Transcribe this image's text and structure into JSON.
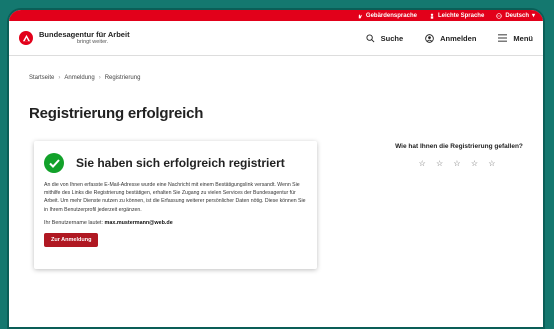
{
  "utility_bar": {
    "sign_language": "Gebärdensprache",
    "easy_language": "Leichte Sprache",
    "language": "Deutsch"
  },
  "header": {
    "logo_title": "Bundesagentur für Arbeit",
    "logo_tagline": "bringt weiter.",
    "search": "Suche",
    "login": "Anmelden",
    "menu": "Menü"
  },
  "breadcrumb": [
    "Startseite",
    "Anmeldung",
    "Registrierung"
  ],
  "page_title": "Registrierung erfolgreich",
  "card": {
    "title": "Sie haben sich erfolgreich registriert",
    "body": "An die von Ihnen erfasste E-Mail-Adresse wurde eine Nachricht mit einem Bestätigungslink versandt. Wenn Sie mithilfe des Links die Registrierung bestätigen, erhalten Sie Zugang zu vielen Services der Bundesagentur für Arbeit. Um mehr Dienste nutzen zu können, ist die Erfassung weiterer persönlicher Daten nötig. Diese können Sie in Ihrem Benutzerprofil jederzeit ergänzen.",
    "username_label": "Ihr Benutzername lautet:",
    "username_value": "max.mustermann@web.de",
    "button": "Zur Anmeldung"
  },
  "feedback": {
    "title": "Wie hat Ihnen die Registrierung gefallen?",
    "stars": [
      "☆",
      "☆",
      "☆",
      "☆",
      "☆"
    ]
  },
  "colors": {
    "brand_red": "#e2001a",
    "success_green": "#12a12a",
    "button_red": "#b01822"
  }
}
